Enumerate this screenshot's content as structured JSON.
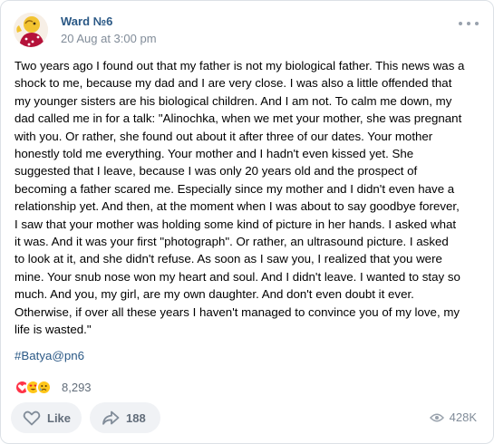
{
  "post": {
    "author": "Ward №6",
    "date": "20 Aug at 3:00 pm",
    "more_icon": "more-horizontal-icon",
    "avatar_icon": "avatar-image",
    "text_lines": [
      "Two years ago I found out that my father is not my biological father. This news was a",
      "shock to me, because my dad and I are very close. I was also a little offended that",
      "my younger sisters are his biological children. And I am not. To calm me down, my",
      "dad called me in for a talk: \"Alinochka, when we met your mother, she was pregnant",
      "with you. Or rather, she found out about it after three of our dates. Your mother",
      "honestly told me everything. Your mother and I hadn't even kissed yet. She",
      "suggested that I leave, because I was only 20 years old and the prospect of",
      "becoming a father scared me. Especially since my mother and I didn't even have a",
      "relationship yet. And then, at the moment when I was about to say goodbye forever,",
      "I saw that your mother was holding some kind of picture in her hands. I asked what",
      "it was. And it was your first \"photograph\". Or rather, an ultrasound picture. I asked",
      "to look at it, and she didn't refuse. As soon as I saw you, I realized that you were",
      "mine. Your snub nose won my heart and soul. And I didn't leave. I wanted to stay so",
      "much. And you, my girl, are my own daughter. And don't even doubt it ever.",
      "Otherwise, if over all these years I haven't managed to convince you of my love, my",
      "life is wasted.\""
    ],
    "hashtag": "#Batya@pn6"
  },
  "reactions": {
    "icons": [
      "heart-reaction-icon",
      "love-eyes-reaction-icon",
      "crying-reaction-icon"
    ],
    "count": "8,293"
  },
  "actions": {
    "like_label": "Like",
    "share_count": "188",
    "views": "428K"
  },
  "colors": {
    "link": "#2a5885",
    "secondary": "#818c99",
    "button_bg": "#f0f2f5",
    "heart": "#ff3347",
    "emoji": "#ffc61a"
  }
}
